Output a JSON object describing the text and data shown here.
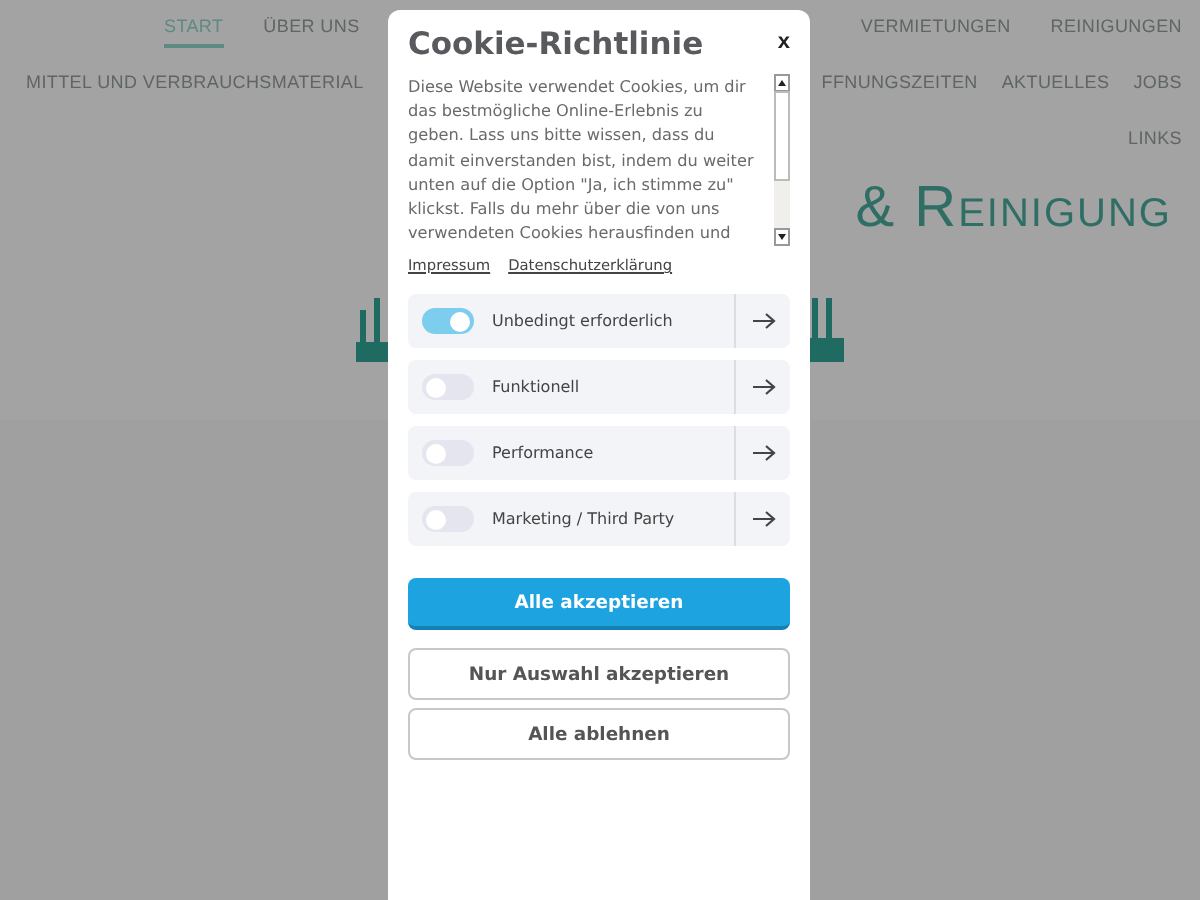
{
  "nav": {
    "row_1": [
      {
        "label": "START",
        "selected": true
      },
      {
        "label": "ÜBER UNS",
        "selected": false
      },
      {
        "label": "VERMIETUNGEN",
        "selected": false
      },
      {
        "label": "REINIGUNGEN",
        "selected": false
      }
    ],
    "row_2": [
      {
        "label": "MITTEL UND VERBRAUCHSMATERIAL",
        "selected": false
      },
      {
        "label": "FFNUNGSZEITEN",
        "selected": false
      },
      {
        "label": "AKTUELLES",
        "selected": false
      },
      {
        "label": "JOBS",
        "selected": false
      }
    ],
    "row_3": [
      {
        "label": "LINKS",
        "selected": false
      }
    ]
  },
  "hero": {
    "heading": "& Reinigung"
  },
  "dialog": {
    "title": "Cookie-Richtlinie",
    "close": "x",
    "text": "Diese Website verwendet Cookies, um dir das bestmögliche Online-Erlebnis zu geben. Lass uns bitte wissen, dass du damit einverstanden bist, indem du weiter unten auf die Option \"Ja, ich stimme zu\" klickst. Falls du mehr über die von uns verwendeten Cookies herausfinden und",
    "links": [
      "Impressum",
      "Datenschutzerklärung"
    ],
    "categories": [
      {
        "label": "Unbedingt erforderlich",
        "on": true
      },
      {
        "label": "Funktionell",
        "on": false
      },
      {
        "label": "Performance",
        "on": false
      },
      {
        "label": "Marketing / Third Party",
        "on": false
      }
    ],
    "buttons": [
      {
        "label": "Alle akzeptieren",
        "kind": "primary"
      },
      {
        "label": "Nur Auswahl akzeptieren",
        "kind": "outline"
      },
      {
        "label": "Alle ablehnen",
        "kind": "outline"
      }
    ]
  }
}
